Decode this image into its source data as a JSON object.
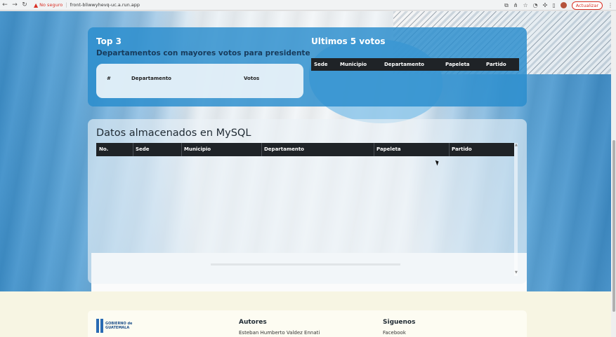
{
  "browser": {
    "security_label": "No seguro",
    "url": "front-bliwwyhevq-uc.a.run.app",
    "update_label": "Actualizar"
  },
  "top3": {
    "title": "Top 3",
    "subtitle": "Departamentos con mayores votos para presidente",
    "headers": [
      "#",
      "Departamento",
      "Votos"
    ]
  },
  "last5": {
    "title": "Ultimos 5 votos",
    "headers": [
      "Sede",
      "Municipio",
      "Departamento",
      "Papeleta",
      "Partido"
    ]
  },
  "mysql": {
    "title": "Datos almacenados en MySQL",
    "headers": [
      "No.",
      "Sede",
      "Municipio",
      "Departamento",
      "Papeleta",
      "Partido"
    ]
  },
  "footer": {
    "logo_line1": "GOBIERNO de",
    "logo_line2": "GUATEMALA",
    "authors_title": "Autores",
    "author_name": "Esteban Humberto Valdez Ennati",
    "follow_title": "Siguenos",
    "follow_link": "Facebook"
  },
  "icons": [
    "back-arrow-icon",
    "forward-arrow-icon",
    "reload-icon",
    "warning-icon",
    "translate-icon",
    "share-icon",
    "star-icon",
    "extension-icon",
    "puzzle-icon",
    "sidebar-icon",
    "profile-avatar",
    "menu-dots-icon"
  ]
}
